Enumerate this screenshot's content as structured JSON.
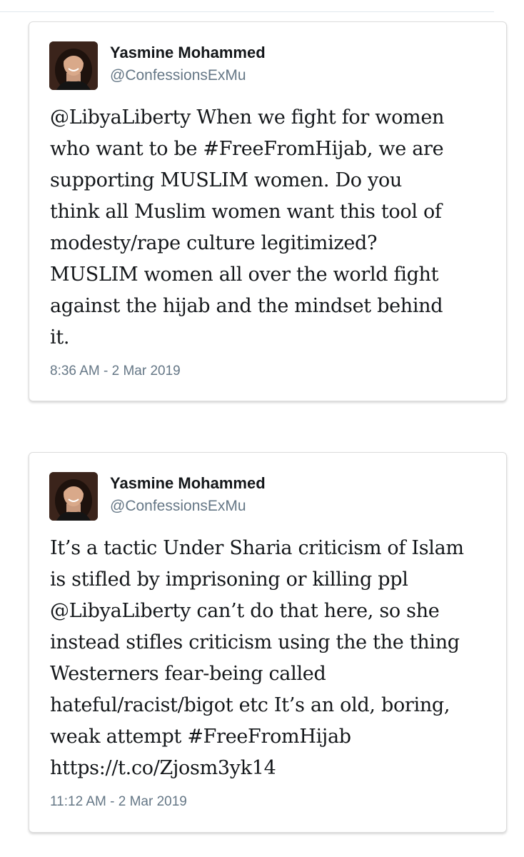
{
  "tweets": [
    {
      "author": {
        "display_name": "Yasmine Mohammed",
        "handle": "@ConfessionsExMu",
        "avatar_icon": "profile-photo"
      },
      "text": "@LibyaLiberty When we fight for women\nwho want to be #FreeFromHijab, we are\nsupporting MUSLIM women. Do you\nthink all Muslim women want this tool of\nmodesty/rape culture legitimized?\nMUSLIM women all over the world fight\nagainst the hijab and the mindset behind\nit.",
      "timestamp": "8:36 AM - 2 Mar 2019"
    },
    {
      "author": {
        "display_name": "Yasmine Mohammed",
        "handle": "@ConfessionsExMu",
        "avatar_icon": "profile-photo"
      },
      "text": "It’s a tactic Under Sharia criticism of Islam\nis stifled by imprisoning or killing ppl\n@LibyaLiberty can’t do that here, so she\ninstead stifles criticism using the the thing\nWesterners fear-being called\nhateful/racist/bigot etc It’s an old, boring,\nweak attempt #FreeFromHijab\nhttps://t.co/Zjosm3yk14",
      "timestamp": "11:12 AM - 2 Mar 2019"
    }
  ],
  "colors": {
    "text_primary": "#14171a",
    "text_secondary": "#657786",
    "card_border": "#dcdcdc",
    "background": "#ffffff"
  }
}
